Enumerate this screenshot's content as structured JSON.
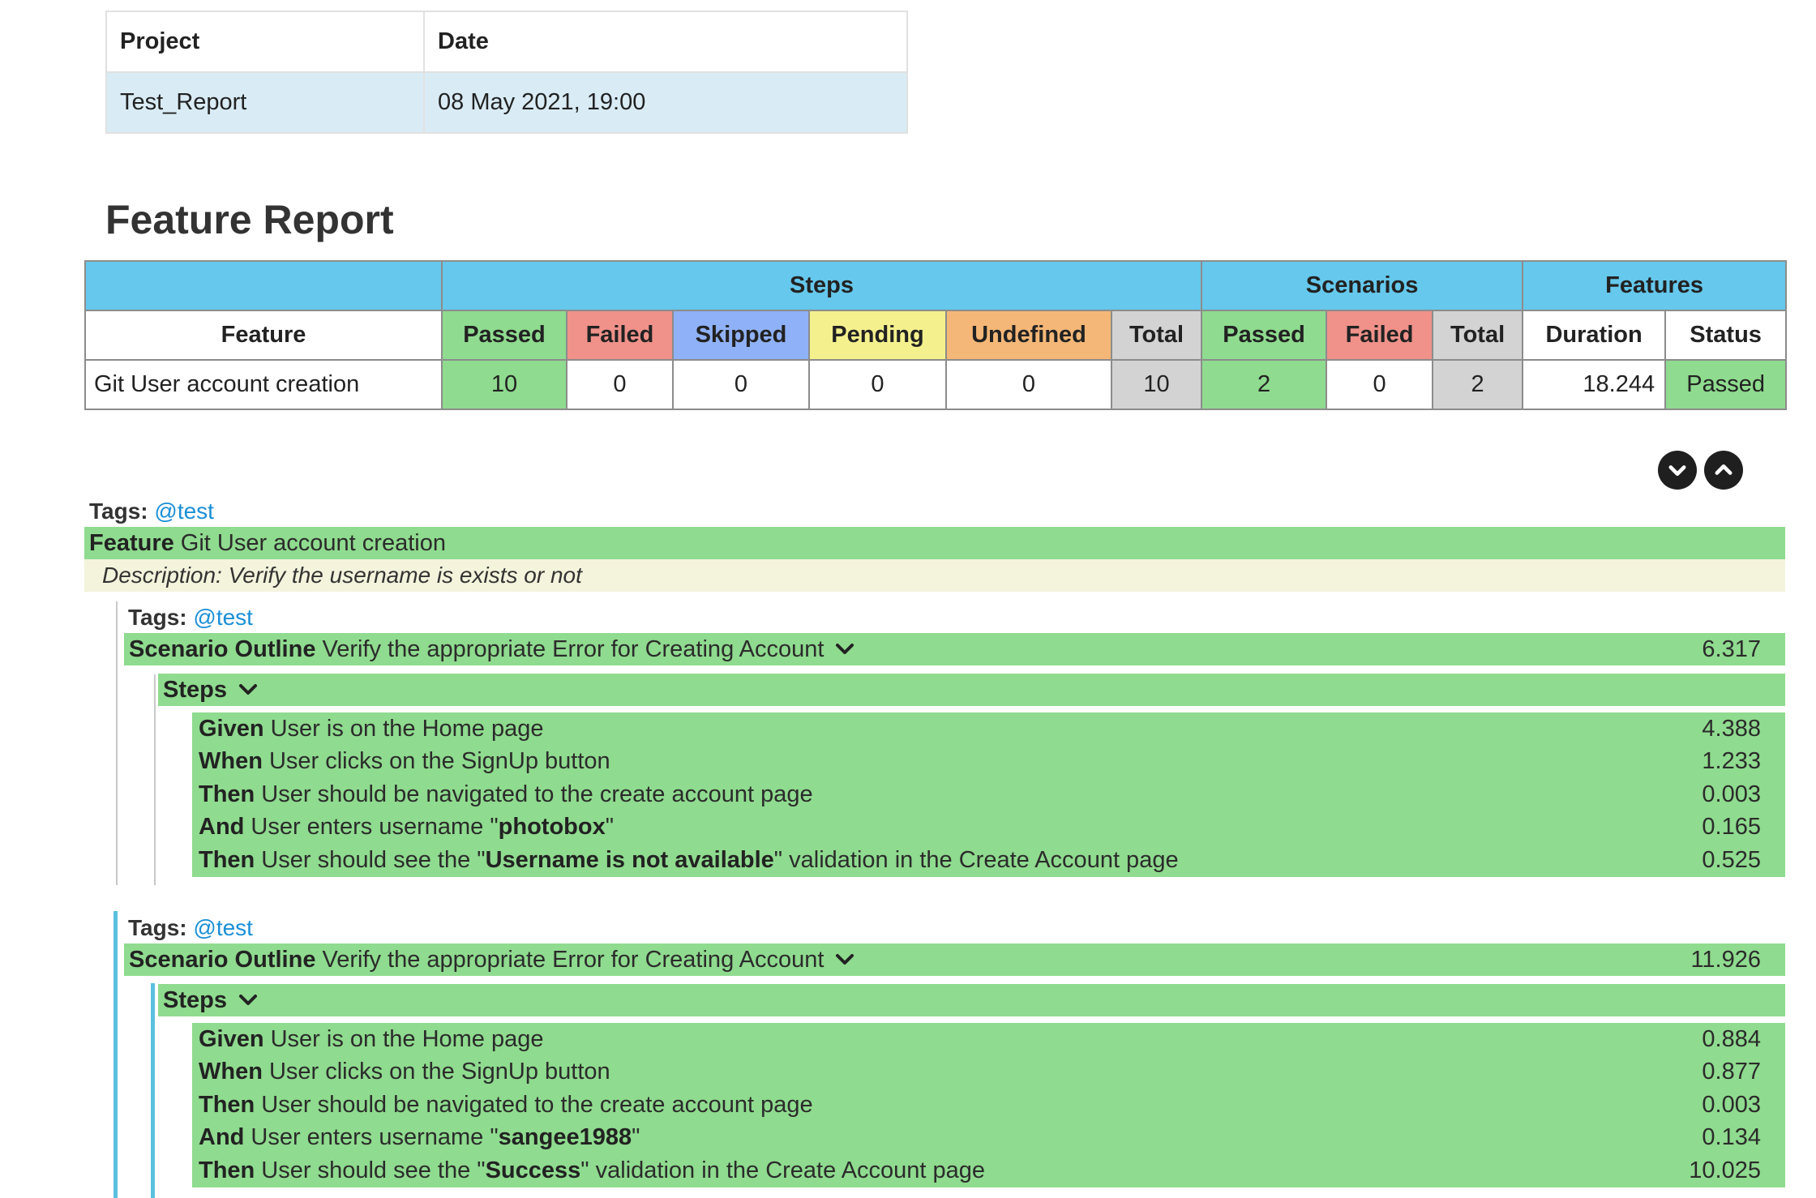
{
  "info": {
    "headers": [
      "Project",
      "Date"
    ],
    "values": [
      "Test_Report",
      "08 May 2021, 19:00"
    ]
  },
  "title": "Feature Report",
  "summary": {
    "groups": {
      "steps": "Steps",
      "scenarios": "Scenarios",
      "features": "Features"
    },
    "headers": {
      "feature": "Feature",
      "steps_passed": "Passed",
      "steps_failed": "Failed",
      "steps_skipped": "Skipped",
      "steps_pending": "Pending",
      "steps_undefined": "Undefined",
      "steps_total": "Total",
      "sc_passed": "Passed",
      "sc_failed": "Failed",
      "sc_total": "Total",
      "duration": "Duration",
      "status": "Status"
    },
    "row": {
      "feature": "Git User account creation",
      "steps_passed": "10",
      "steps_failed": "0",
      "steps_skipped": "0",
      "steps_pending": "0",
      "steps_undefined": "0",
      "steps_total": "10",
      "sc_passed": "2",
      "sc_failed": "0",
      "sc_total": "2",
      "duration": "18.244",
      "status": "Passed"
    },
    "colors": {
      "passed": "#8fdb8f",
      "failed": "#f0928a",
      "skipped": "#8fb1f7",
      "pending": "#f4f08d",
      "undefined": "#f5b777",
      "total": "#d3d3d3",
      "group": "#65c8ec"
    }
  },
  "controls": {
    "expand_icon": "chevron-down-icon",
    "collapse_icon": "chevron-up-icon"
  },
  "feature": {
    "tags_label": "Tags:",
    "tag": "@test",
    "keyword": "Feature",
    "name": "Git User account creation",
    "description": "Description: Verify the username is exists or not",
    "scenarios": [
      {
        "tags_label": "Tags:",
        "tag": "@test",
        "keyword": "Scenario Outline",
        "name": "Verify the appropriate Error for Creating Account",
        "duration": "6.317",
        "steps_label": "Steps",
        "steps": [
          {
            "kw": "Given",
            "pre": "User is on the Home page",
            "arg": "",
            "post": "",
            "duration": "4.388"
          },
          {
            "kw": "When",
            "pre": "User clicks on the SignUp button",
            "arg": "",
            "post": "",
            "duration": "1.233"
          },
          {
            "kw": "Then",
            "pre": "User should be navigated to the create account page",
            "arg": "",
            "post": "",
            "duration": "0.003"
          },
          {
            "kw": "And",
            "pre": "User enters username \"",
            "arg": "photobox",
            "post": "\"",
            "duration": "0.165"
          },
          {
            "kw": "Then",
            "pre": "User should see the \"",
            "arg": "Username is not available",
            "post": "\" validation in the Create Account page",
            "duration": "0.525"
          }
        ]
      },
      {
        "tags_label": "Tags:",
        "tag": "@test",
        "keyword": "Scenario Outline",
        "name": "Verify the appropriate Error for Creating Account",
        "duration": "11.926",
        "steps_label": "Steps",
        "steps": [
          {
            "kw": "Given",
            "pre": "User is on the Home page",
            "arg": "",
            "post": "",
            "duration": "0.884"
          },
          {
            "kw": "When",
            "pre": "User clicks on the SignUp button",
            "arg": "",
            "post": "",
            "duration": "0.877"
          },
          {
            "kw": "Then",
            "pre": "User should be navigated to the create account page",
            "arg": "",
            "post": "",
            "duration": "0.003"
          },
          {
            "kw": "And",
            "pre": "User enters username \"",
            "arg": "sangee1988",
            "post": "\"",
            "duration": "0.134"
          },
          {
            "kw": "Then",
            "pre": "User should see the \"",
            "arg": "Success",
            "post": "\" validation in the Create Account page",
            "duration": "10.025"
          }
        ]
      }
    ]
  }
}
